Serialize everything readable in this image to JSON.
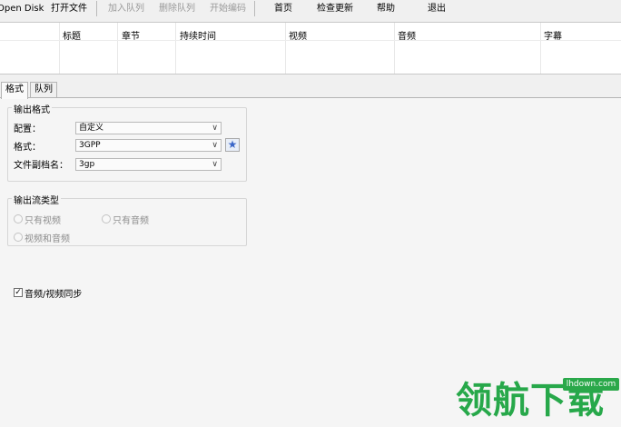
{
  "toolbar": {
    "open_disk": "Open Disk",
    "open_file": "打开文件",
    "add_queue": "加入队列",
    "remove_queue": "删除队列",
    "start_encode": "开始编码",
    "home": "首页",
    "check_update": "检查更新",
    "help": "帮助",
    "exit": "退出"
  },
  "table": {
    "columns": [
      "标题",
      "章节",
      "持续时间",
      "视频",
      "音频",
      "字幕"
    ]
  },
  "tabs": {
    "format": "格式",
    "queue": "队列"
  },
  "output_format": {
    "group_title": "输出格式",
    "config_label": "配置：",
    "config_value": "自定义",
    "format_label": "格式：",
    "format_value": "3GPP",
    "ext_label": "文件副档名：",
    "ext_value": "3gp"
  },
  "stream_type": {
    "group_title": "输出流类型",
    "video_only": "只有视频",
    "audio_only": "只有音频",
    "video_audio": "视频和音频"
  },
  "sync": {
    "label": "音频/视频同步",
    "checked": true
  },
  "watermark": {
    "text": "领航下载",
    "url": "lhdown.com"
  }
}
